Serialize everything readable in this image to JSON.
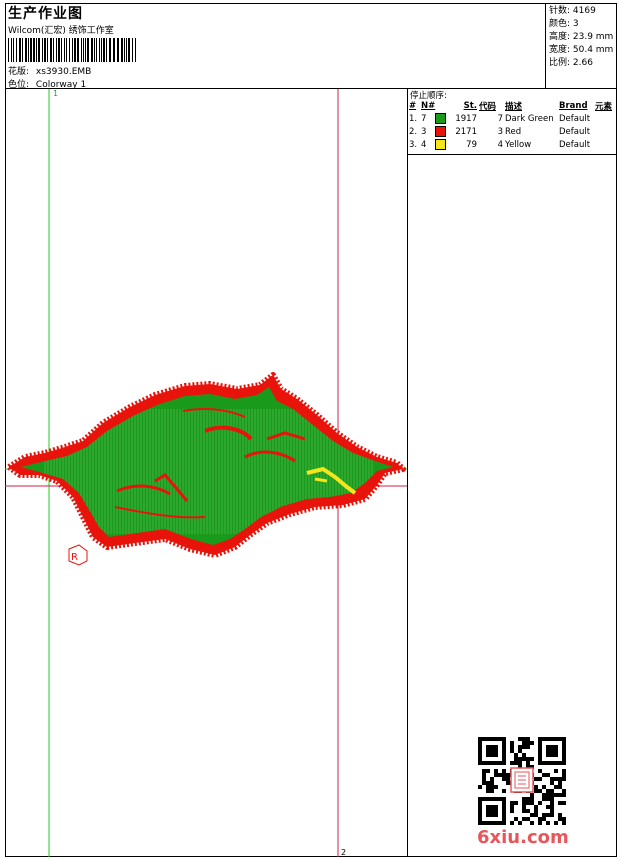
{
  "header": {
    "title": "生产作业图",
    "company": "Wilcom(汇宏) 绣饰工作室",
    "design_label": "花版:",
    "design_value": "xs3930.EMB",
    "colorway_label": "色位:",
    "colorway_value": "Colorway 1"
  },
  "stats": {
    "stitches": "针数: 4169",
    "colors": "颜色: 3",
    "height": "高度: 23.9 mm",
    "width": "宽度: 50.4 mm",
    "ratio": "比例: 2.66"
  },
  "design_area": {
    "marker_1": "1",
    "marker_2": "2",
    "registered_mark": "R"
  },
  "stop_sequence": {
    "title": "停止顺序:",
    "columns": [
      "#",
      "N#",
      "St.",
      "代码",
      "描述",
      "Brand",
      "元素"
    ],
    "rows": [
      {
        "idx": "1.",
        "n": "7",
        "color": "#1a9a1a",
        "st": "1917",
        "code": "7",
        "desc": "Dark Green",
        "brand": "Default"
      },
      {
        "idx": "2.",
        "n": "3",
        "color": "#e8140c",
        "st": "2171",
        "code": "3",
        "desc": "Red",
        "brand": "Default"
      },
      {
        "idx": "3.",
        "n": "4",
        "color": "#f5e61a",
        "st": "79",
        "code": "4",
        "desc": "Yellow",
        "brand": "Default"
      }
    ]
  },
  "watermark": {
    "text": "6xiu.com"
  }
}
